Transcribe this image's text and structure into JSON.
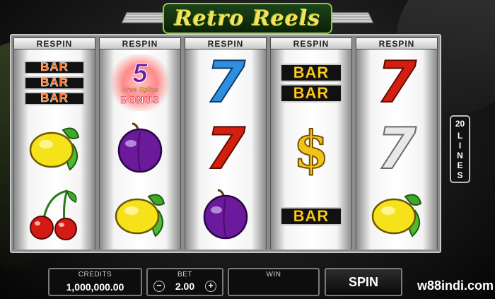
{
  "game": {
    "logo_text": "Retro Reels",
    "lines_count": "20",
    "lines_word": [
      "L",
      "I",
      "N",
      "E",
      "S"
    ]
  },
  "reels": [
    {
      "respin_label": "RESPIN",
      "symbols": [
        {
          "type": "bar-stack",
          "lines": [
            "BAR",
            "BAR",
            "BAR"
          ]
        },
        {
          "type": "lemon"
        },
        {
          "type": "cherries"
        }
      ]
    },
    {
      "respin_label": "RESPIN",
      "symbols": [
        {
          "type": "bonus",
          "number": "5",
          "subtext": "Free Spins",
          "word": "BONUS"
        },
        {
          "type": "plum"
        },
        {
          "type": "lemon"
        }
      ]
    },
    {
      "respin_label": "RESPIN",
      "symbols": [
        {
          "type": "seven",
          "color": "#2e8fe0",
          "text": "7"
        },
        {
          "type": "seven",
          "color": "#d41f10",
          "text": "7"
        },
        {
          "type": "plum"
        }
      ]
    },
    {
      "respin_label": "RESPIN",
      "symbols": [
        {
          "type": "bar-stack",
          "lines": [
            "BAR",
            "BAR"
          ]
        },
        {
          "type": "dollar",
          "text": "$"
        },
        {
          "type": "bar-single",
          "text": "BAR"
        }
      ]
    },
    {
      "respin_label": "RESPIN",
      "symbols": [
        {
          "type": "seven",
          "color": "#d41f10",
          "text": "7"
        },
        {
          "type": "seven",
          "color": "#e8e8e8",
          "text": "7"
        },
        {
          "type": "lemon"
        }
      ]
    }
  ],
  "panel": {
    "credits_label": "CREDITS",
    "credits_value": "1,000,000.00",
    "bet_label": "BET",
    "bet_value": "2.00",
    "bet_minus": "−",
    "bet_plus": "+",
    "win_label": "WIN",
    "win_value": "",
    "spin_label": "SPIN"
  },
  "watermark": "w88indi.com"
}
